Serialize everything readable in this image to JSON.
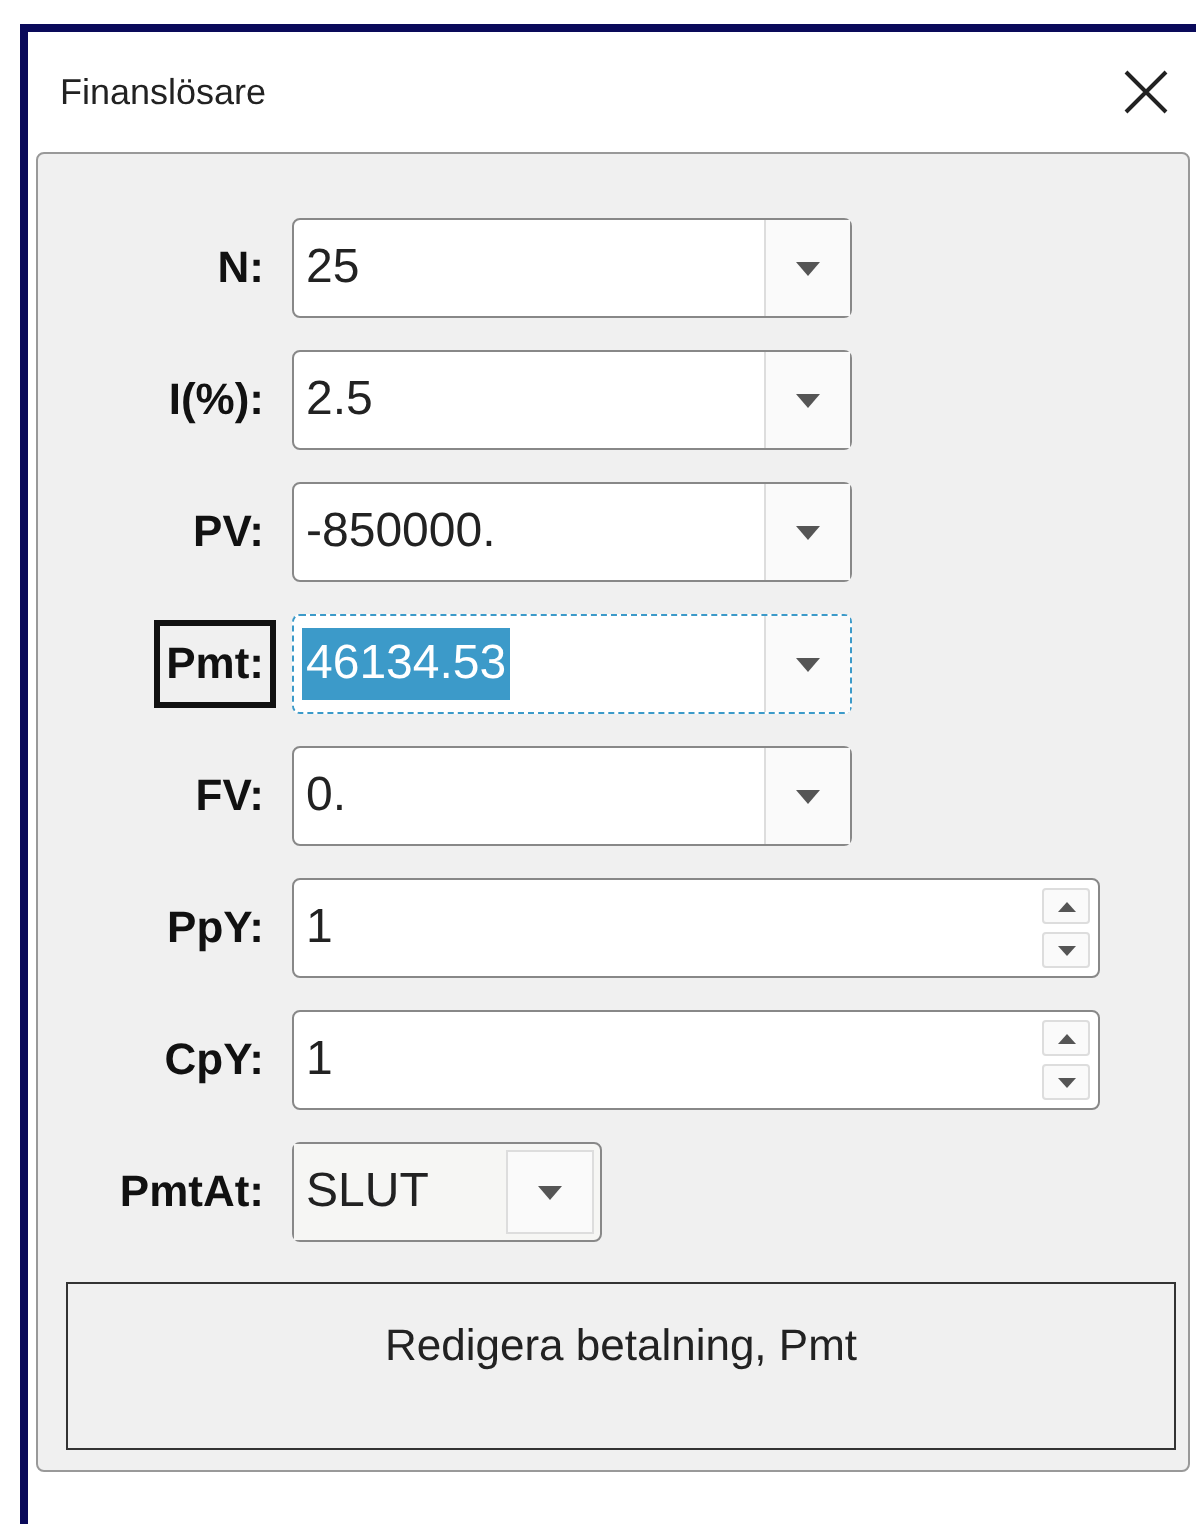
{
  "window": {
    "title": "Finanslösare"
  },
  "fields": [
    {
      "label": "N:",
      "kind": "combo",
      "value": "25",
      "selected": false
    },
    {
      "label": "I(%):",
      "kind": "combo",
      "value": "2.5",
      "selected": false
    },
    {
      "label": "PV:",
      "kind": "combo",
      "value": "-850000.",
      "selected": false
    },
    {
      "label": "Pmt:",
      "kind": "combo",
      "value": "46134.53",
      "selected": true
    },
    {
      "label": "FV:",
      "kind": "combo",
      "value": "0.",
      "selected": false
    },
    {
      "label": "PpY:",
      "kind": "spin",
      "value": "1",
      "selected": false
    },
    {
      "label": "CpY:",
      "kind": "spin",
      "value": "1",
      "selected": false
    },
    {
      "label": "PmtAt:",
      "kind": "dropdown",
      "value": "SLUT",
      "selected": false
    }
  ],
  "message": "Redigera betalning, Pmt"
}
